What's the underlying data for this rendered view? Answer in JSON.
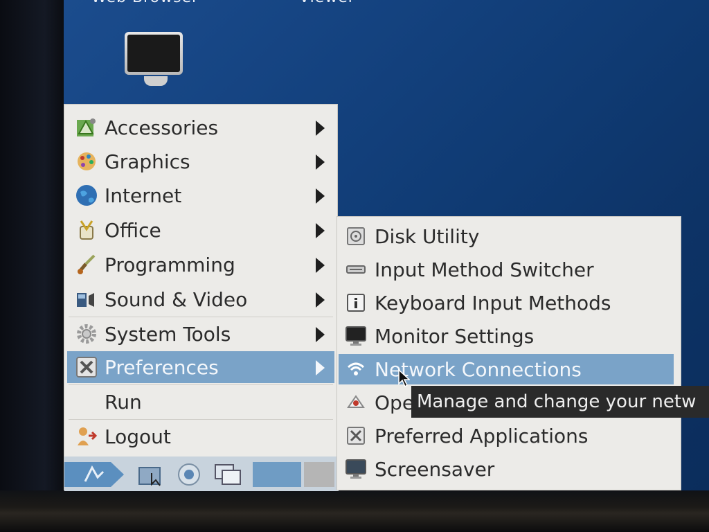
{
  "desktop": {
    "labels": [
      "Web Browser",
      "Viewer"
    ],
    "icon": "monitor-icon"
  },
  "menu": {
    "items": [
      {
        "label": "Accessories",
        "icon": "accessories-icon",
        "submenu": true
      },
      {
        "label": "Graphics",
        "icon": "graphics-icon",
        "submenu": true
      },
      {
        "label": "Internet",
        "icon": "globe-icon",
        "submenu": true
      },
      {
        "label": "Office",
        "icon": "office-icon",
        "submenu": true
      },
      {
        "label": "Programming",
        "icon": "programming-icon",
        "submenu": true
      },
      {
        "label": "Sound & Video",
        "icon": "sound-video-icon",
        "submenu": true
      },
      {
        "label": "System Tools",
        "icon": "gear-icon",
        "submenu": true
      },
      {
        "label": "Preferences",
        "icon": "preferences-icon",
        "submenu": true,
        "selected": true
      },
      {
        "label": "Run",
        "icon": "",
        "submenu": false
      },
      {
        "label": "Logout",
        "icon": "logout-icon",
        "submenu": false
      }
    ]
  },
  "submenu": {
    "items": [
      {
        "label": "Disk Utility",
        "icon": "disk-utility-icon"
      },
      {
        "label": "Input Method Switcher",
        "icon": "keyboard-icon"
      },
      {
        "label": "Keyboard Input Methods",
        "icon": "info-icon"
      },
      {
        "label": "Monitor Settings",
        "icon": "monitor-icon"
      },
      {
        "label": "Network Connections",
        "icon": "wifi-icon",
        "selected": true
      },
      {
        "label": "Ope",
        "icon": "openbox-icon"
      },
      {
        "label": "Preferred Applications",
        "icon": "preferences-icon"
      },
      {
        "label": "Screensaver",
        "icon": "screensaver-icon"
      }
    ]
  },
  "tooltip": {
    "text": "Manage and change your netw"
  },
  "taskbar": {
    "items": [
      "start-menu-icon",
      "file-manager-icon",
      "browser-icon",
      "window-switcher-icon"
    ]
  },
  "colors": {
    "desktop": "#14427f",
    "menu_bg": "#ecebe8",
    "selection": "#7aa3c8",
    "tooltip_bg": "#2a2a2a"
  }
}
